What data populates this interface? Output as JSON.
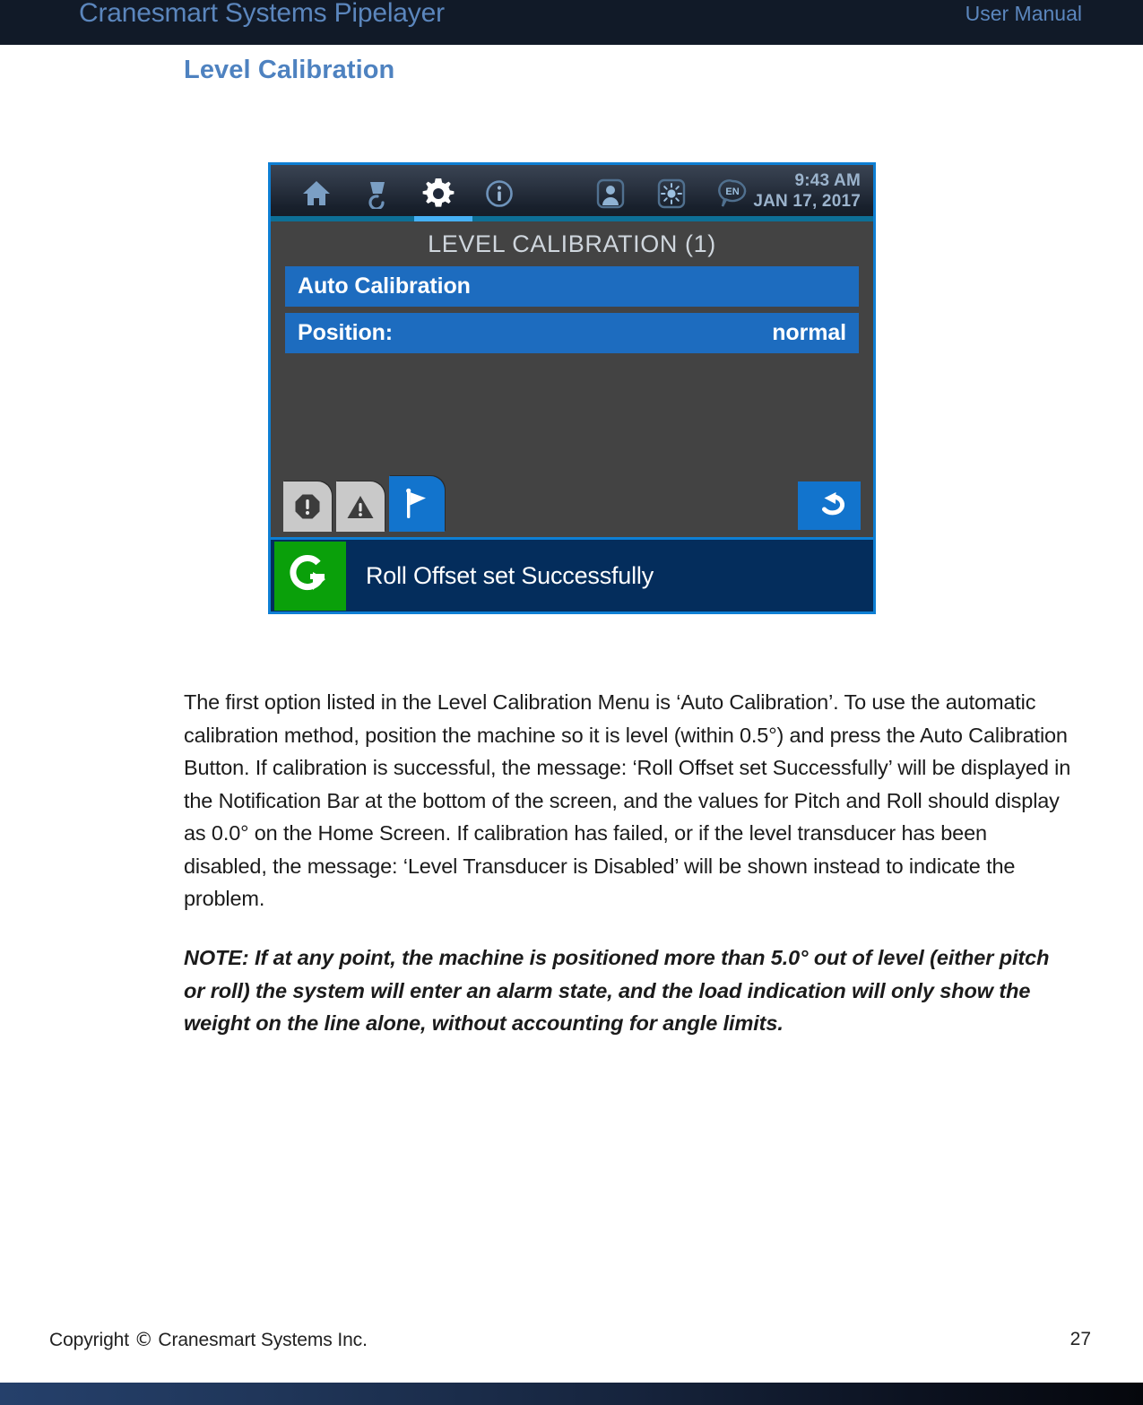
{
  "header": {
    "title": "Cranesmart Systems Pipelayer",
    "right_label": "User Manual"
  },
  "section": {
    "heading": "Level Calibration"
  },
  "device": {
    "topbar": {
      "icons": [
        {
          "name": "home-icon",
          "label": "Home"
        },
        {
          "name": "load-hook-icon",
          "label": "Load"
        },
        {
          "name": "gear-icon",
          "label": "Settings"
        },
        {
          "name": "info-icon",
          "label": "Info"
        },
        {
          "name": "user-icon",
          "label": "User"
        },
        {
          "name": "brightness-icon",
          "label": "Brightness"
        },
        {
          "name": "language-icon",
          "label": "EN"
        }
      ],
      "language_code": "EN",
      "time": "9:43 AM",
      "date": "JAN 17, 2017",
      "active_tab": "gear-icon"
    },
    "menu_title": "LEVEL CALIBRATION (1)",
    "rows": [
      {
        "label": "Auto Calibration",
        "value": ""
      },
      {
        "label": "Position:",
        "value": "normal"
      }
    ],
    "buttons": [
      {
        "name": "stop-alarm-tab",
        "label": "Stop Alarm",
        "active": false
      },
      {
        "name": "warning-tab",
        "label": "Warning",
        "active": false
      },
      {
        "name": "flag-tab",
        "label": "Flag",
        "active": true
      },
      {
        "name": "back-button",
        "label": "Back",
        "active": false
      }
    ],
    "notification": {
      "icon": "calibration-success-icon",
      "message": "Roll Offset set Successfully",
      "icon_color": "#0aa00a",
      "bar_color": "#042d5c"
    }
  },
  "body": {
    "paragraph1": "The first option listed in the Level Calibration Menu is ‘Auto Calibration’.  To use the automatic calibration method, position the machine so it is level (within 0.5°) and press the Auto Calibration Button.  If calibration is successful, the message: ‘Roll Offset set Successfully’ will be displayed in the Notification Bar at the bottom of the screen, and the values for Pitch and Roll should display as 0.0° on the Home Screen.  If calibration has failed, or if the level transducer has been disabled, the message: ‘Level Transducer is Disabled’ will be shown instead to indicate the problem.",
    "note": "NOTE:  If at any point, the machine is positioned more than 5.0° out of level (either pitch or roll) the system will enter an alarm state, and the load indication will only show the weight on the line alone, without accounting for angle limits."
  },
  "footer": {
    "copyright_prefix": "Copyright",
    "copyright_symbol": "©",
    "copyright_text": "Cranesmart Systems Inc.",
    "page_number": "27"
  },
  "colors": {
    "header_bg": "#111a28",
    "header_text": "#5b86bd",
    "heading": "#4e82c0",
    "device_border": "#0e7fd4",
    "menu_row": "#1d6cbf",
    "accent_active": "#46b1f5"
  }
}
